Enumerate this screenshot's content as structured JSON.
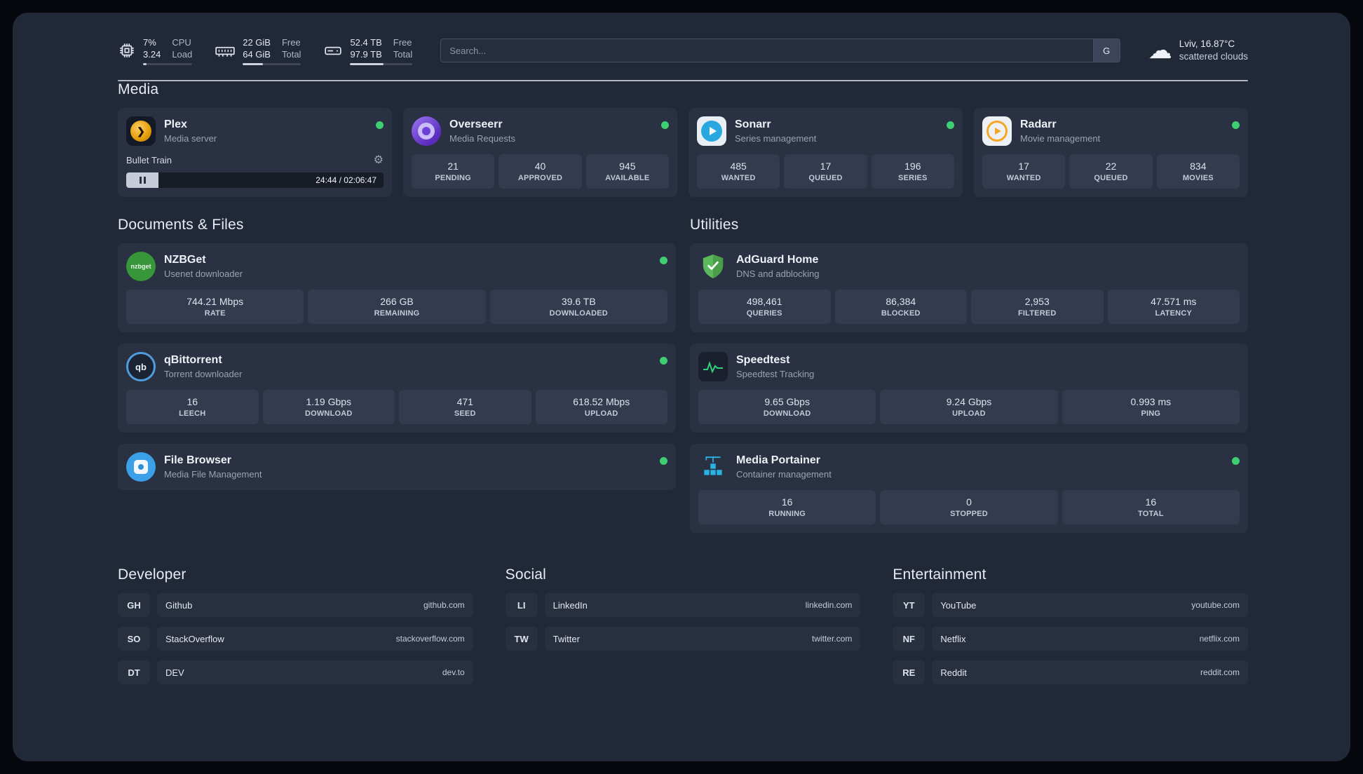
{
  "topbar": {
    "cpu": {
      "value": "7%",
      "load": "3.24",
      "label_top": "CPU",
      "label_bottom": "Load",
      "bar_pct": 7
    },
    "ram": {
      "free": "22 GiB",
      "total": "64 GiB",
      "label_top": "Free",
      "label_bottom": "Total",
      "bar_pct": 34
    },
    "disk": {
      "free": "52.4 TB",
      "total": "97.9 TB",
      "label_top": "Free",
      "label_bottom": "Total",
      "bar_pct": 54
    },
    "search": {
      "placeholder": "Search...",
      "engine": "G"
    },
    "weather": {
      "location": "Lviv, 16.87°C",
      "condition": "scattered clouds"
    }
  },
  "sections": {
    "media": "Media",
    "documents": "Documents & Files",
    "utilities": "Utilities",
    "developer": "Developer",
    "social": "Social",
    "entertainment": "Entertainment"
  },
  "apps": {
    "plex": {
      "title": "Plex",
      "subtitle": "Media server",
      "now_playing": "Bullet Train",
      "time": "24:44 / 02:06:47",
      "progress_pct": 19
    },
    "overseerr": {
      "title": "Overseerr",
      "subtitle": "Media Requests",
      "stats": [
        {
          "value": "21",
          "label": "PENDING"
        },
        {
          "value": "40",
          "label": "APPROVED"
        },
        {
          "value": "945",
          "label": "AVAILABLE"
        }
      ]
    },
    "sonarr": {
      "title": "Sonarr",
      "subtitle": "Series management",
      "stats": [
        {
          "value": "485",
          "label": "WANTED"
        },
        {
          "value": "17",
          "label": "QUEUED"
        },
        {
          "value": "196",
          "label": "SERIES"
        }
      ]
    },
    "radarr": {
      "title": "Radarr",
      "subtitle": "Movie management",
      "stats": [
        {
          "value": "17",
          "label": "WANTED"
        },
        {
          "value": "22",
          "label": "QUEUED"
        },
        {
          "value": "834",
          "label": "MOVIES"
        }
      ]
    },
    "nzbget": {
      "title": "NZBGet",
      "subtitle": "Usenet downloader",
      "icon_text": "nzbget",
      "stats": [
        {
          "value": "744.21 Mbps",
          "label": "RATE"
        },
        {
          "value": "266 GB",
          "label": "REMAINING"
        },
        {
          "value": "39.6 TB",
          "label": "DOWNLOADED"
        }
      ]
    },
    "qbittorrent": {
      "title": "qBittorrent",
      "subtitle": "Torrent downloader",
      "icon_text": "qb",
      "stats": [
        {
          "value": "16",
          "label": "LEECH"
        },
        {
          "value": "1.19 Gbps",
          "label": "DOWNLOAD"
        },
        {
          "value": "471",
          "label": "SEED"
        },
        {
          "value": "618.52 Mbps",
          "label": "UPLOAD"
        }
      ]
    },
    "filebrowser": {
      "title": "File Browser",
      "subtitle": "Media File Management"
    },
    "adguard": {
      "title": "AdGuard Home",
      "subtitle": "DNS and adblocking",
      "stats": [
        {
          "value": "498,461",
          "label": "QUERIES"
        },
        {
          "value": "86,384",
          "label": "BLOCKED"
        },
        {
          "value": "2,953",
          "label": "FILTERED"
        },
        {
          "value": "47.571 ms",
          "label": "LATENCY"
        }
      ]
    },
    "speedtest": {
      "title": "Speedtest",
      "subtitle": "Speedtest Tracking",
      "stats": [
        {
          "value": "9.65 Gbps",
          "label": "DOWNLOAD"
        },
        {
          "value": "9.24 Gbps",
          "label": "UPLOAD"
        },
        {
          "value": "0.993 ms",
          "label": "PING"
        }
      ]
    },
    "portainer": {
      "title": "Media Portainer",
      "subtitle": "Container management",
      "stats": [
        {
          "value": "16",
          "label": "RUNNING"
        },
        {
          "value": "0",
          "label": "STOPPED"
        },
        {
          "value": "16",
          "label": "TOTAL"
        }
      ]
    }
  },
  "links": {
    "developer": [
      {
        "abbr": "GH",
        "name": "Github",
        "url": "github.com"
      },
      {
        "abbr": "SO",
        "name": "StackOverflow",
        "url": "stackoverflow.com"
      },
      {
        "abbr": "DT",
        "name": "DEV",
        "url": "dev.to"
      }
    ],
    "social": [
      {
        "abbr": "LI",
        "name": "LinkedIn",
        "url": "linkedin.com"
      },
      {
        "abbr": "TW",
        "name": "Twitter",
        "url": "twitter.com"
      }
    ],
    "entertainment": [
      {
        "abbr": "YT",
        "name": "YouTube",
        "url": "youtube.com"
      },
      {
        "abbr": "NF",
        "name": "Netflix",
        "url": "netflix.com"
      },
      {
        "abbr": "RE",
        "name": "Reddit",
        "url": "reddit.com"
      }
    ]
  },
  "colors": {
    "status_online": "#3ecf72",
    "page_bg": "#212837",
    "card_bg": "#2a3142",
    "tile_bg": "#333b4e"
  }
}
